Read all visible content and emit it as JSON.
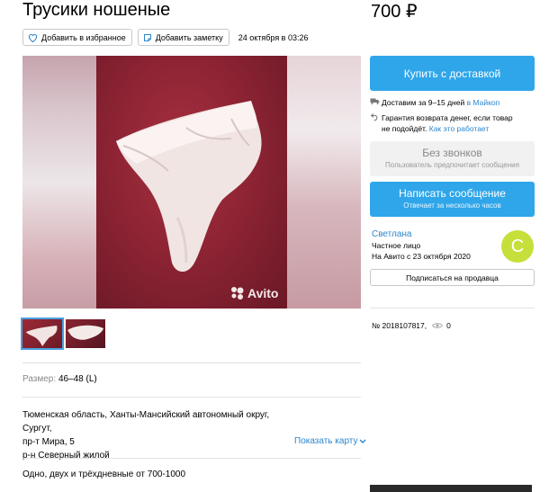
{
  "listing": {
    "title": "Трусики ношеные",
    "price": "700 ₽",
    "favorite_label": "Добавить в избранное",
    "note_label": "Добавить заметку",
    "date": "24 октября в 03:26",
    "watermark": "Avito"
  },
  "details": {
    "size_label": "Размер:",
    "size_value": "46–48 (L)",
    "address_line1": "Тюменская область, Ханты-Мансийский автономный округ, Сургут,",
    "address_line2": "пр-т Мира, 5",
    "address_line3": "р-н Северный жилой",
    "show_map": "Показать карту",
    "description": "Одно, двух и трёхдневные от 700-1000"
  },
  "sidebar": {
    "buy_button": "Купить с доставкой",
    "delivery_text": "Доставим за 9–15 дней ",
    "delivery_link": "в Майкоп",
    "guarantee_text": "Гарантия возврата денег, если товар",
    "guarantee_text2": "не подойдёт.",
    "guarantee_link": "Как это работает",
    "nocall_title": "Без звонков",
    "nocall_sub": "Пользователь предпочитает сообщения",
    "message_title": "Написать сообщение",
    "message_sub": "Отвечает за несколько часов",
    "seller_name": "Светлана",
    "seller_type": "Частное лицо",
    "seller_since": "На Авито с 23 октября 2020",
    "avatar_letter": "С",
    "subscribe_label": "Подписаться на продавца",
    "listing_number": "№ 2018107817,",
    "views": "0"
  },
  "colors": {
    "accent": "#2fa6ea",
    "link": "#2d86cc",
    "avatar": "#c7df3a"
  }
}
